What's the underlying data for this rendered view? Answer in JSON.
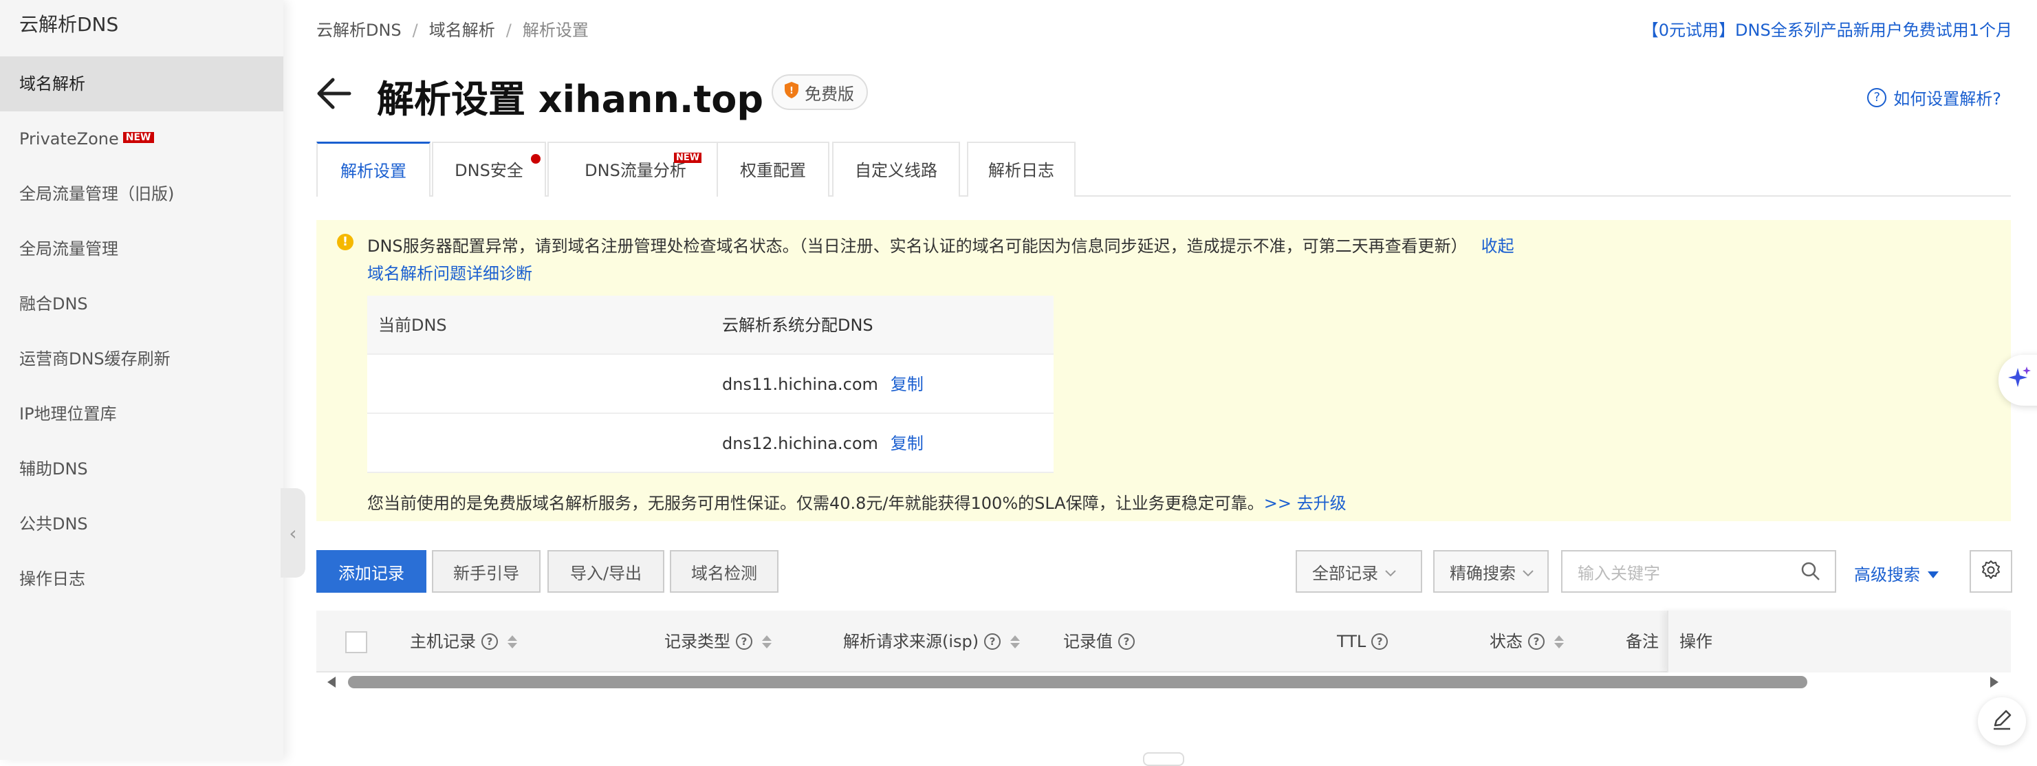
{
  "sidebar": {
    "title": "云解析DNS",
    "items": [
      {
        "label": "域名解析"
      },
      {
        "label": "PrivateZone",
        "badge": "NEW"
      },
      {
        "label": "全局流量管理（旧版)"
      },
      {
        "label": "全局流量管理"
      },
      {
        "label": "融合DNS"
      },
      {
        "label": "运营商DNS缓存刷新"
      },
      {
        "label": "IP地理位置库"
      },
      {
        "label": "辅助DNS"
      },
      {
        "label": "公共DNS"
      },
      {
        "label": "操作日志"
      }
    ]
  },
  "breadcrumb": [
    "云解析DNS",
    "域名解析",
    "解析设置"
  ],
  "breadcrumb_sep": "/",
  "promo": "【0元试用】DNS全系列产品新用户免费试用1个月",
  "header": {
    "title": "解析设置 xihann.top",
    "edition": "免费版",
    "howto": "如何设置解析?"
  },
  "tabs": [
    {
      "label": "解析设置"
    },
    {
      "label": "DNS安全"
    },
    {
      "label": "DNS流量分析",
      "badge": "NEW"
    },
    {
      "label": "权重配置"
    },
    {
      "label": "自定义线路"
    },
    {
      "label": "解析日志"
    }
  ],
  "alert": {
    "message": "DNS服务器配置异常，请到域名注册管理处检查域名状态。（当日注册、实名认证的域名可能因为信息同步延迟，造成提示不准，可第二天再查看更新）",
    "collapse": "收起",
    "diagnose": "域名解析问题详细诊断",
    "table": {
      "headers": [
        "当前DNS",
        "云解析系统分配DNS"
      ],
      "rows": [
        {
          "current": "",
          "assigned": "dns11.hichina.com",
          "action": "复制"
        },
        {
          "current": "",
          "assigned": "dns12.hichina.com",
          "action": "复制"
        }
      ]
    },
    "upgrade_text": "您当前使用的是免费版域名解析服务，无服务可用性保证。仅需40.8元/年就能获得100%的SLA保障，让业务更稳定可靠。",
    "upgrade_link": ">> 去升级"
  },
  "toolbar": {
    "add": "添加记录",
    "guide": "新手引导",
    "import_export": "导入/导出",
    "check": "域名检测",
    "record_filter": "全部记录",
    "search_mode": "精确搜索",
    "search_placeholder": "输入关键字",
    "advanced": "高级搜索"
  },
  "records_table": {
    "columns": [
      "主机记录",
      "记录类型",
      "解析请求来源(isp)",
      "记录值",
      "TTL",
      "状态",
      "备注",
      "操作"
    ]
  },
  "colors": {
    "primary": "#2a6fd6",
    "link": "#1a5fd0",
    "alert_bg": "#fdfde0",
    "badge_red": "#cc0000"
  }
}
